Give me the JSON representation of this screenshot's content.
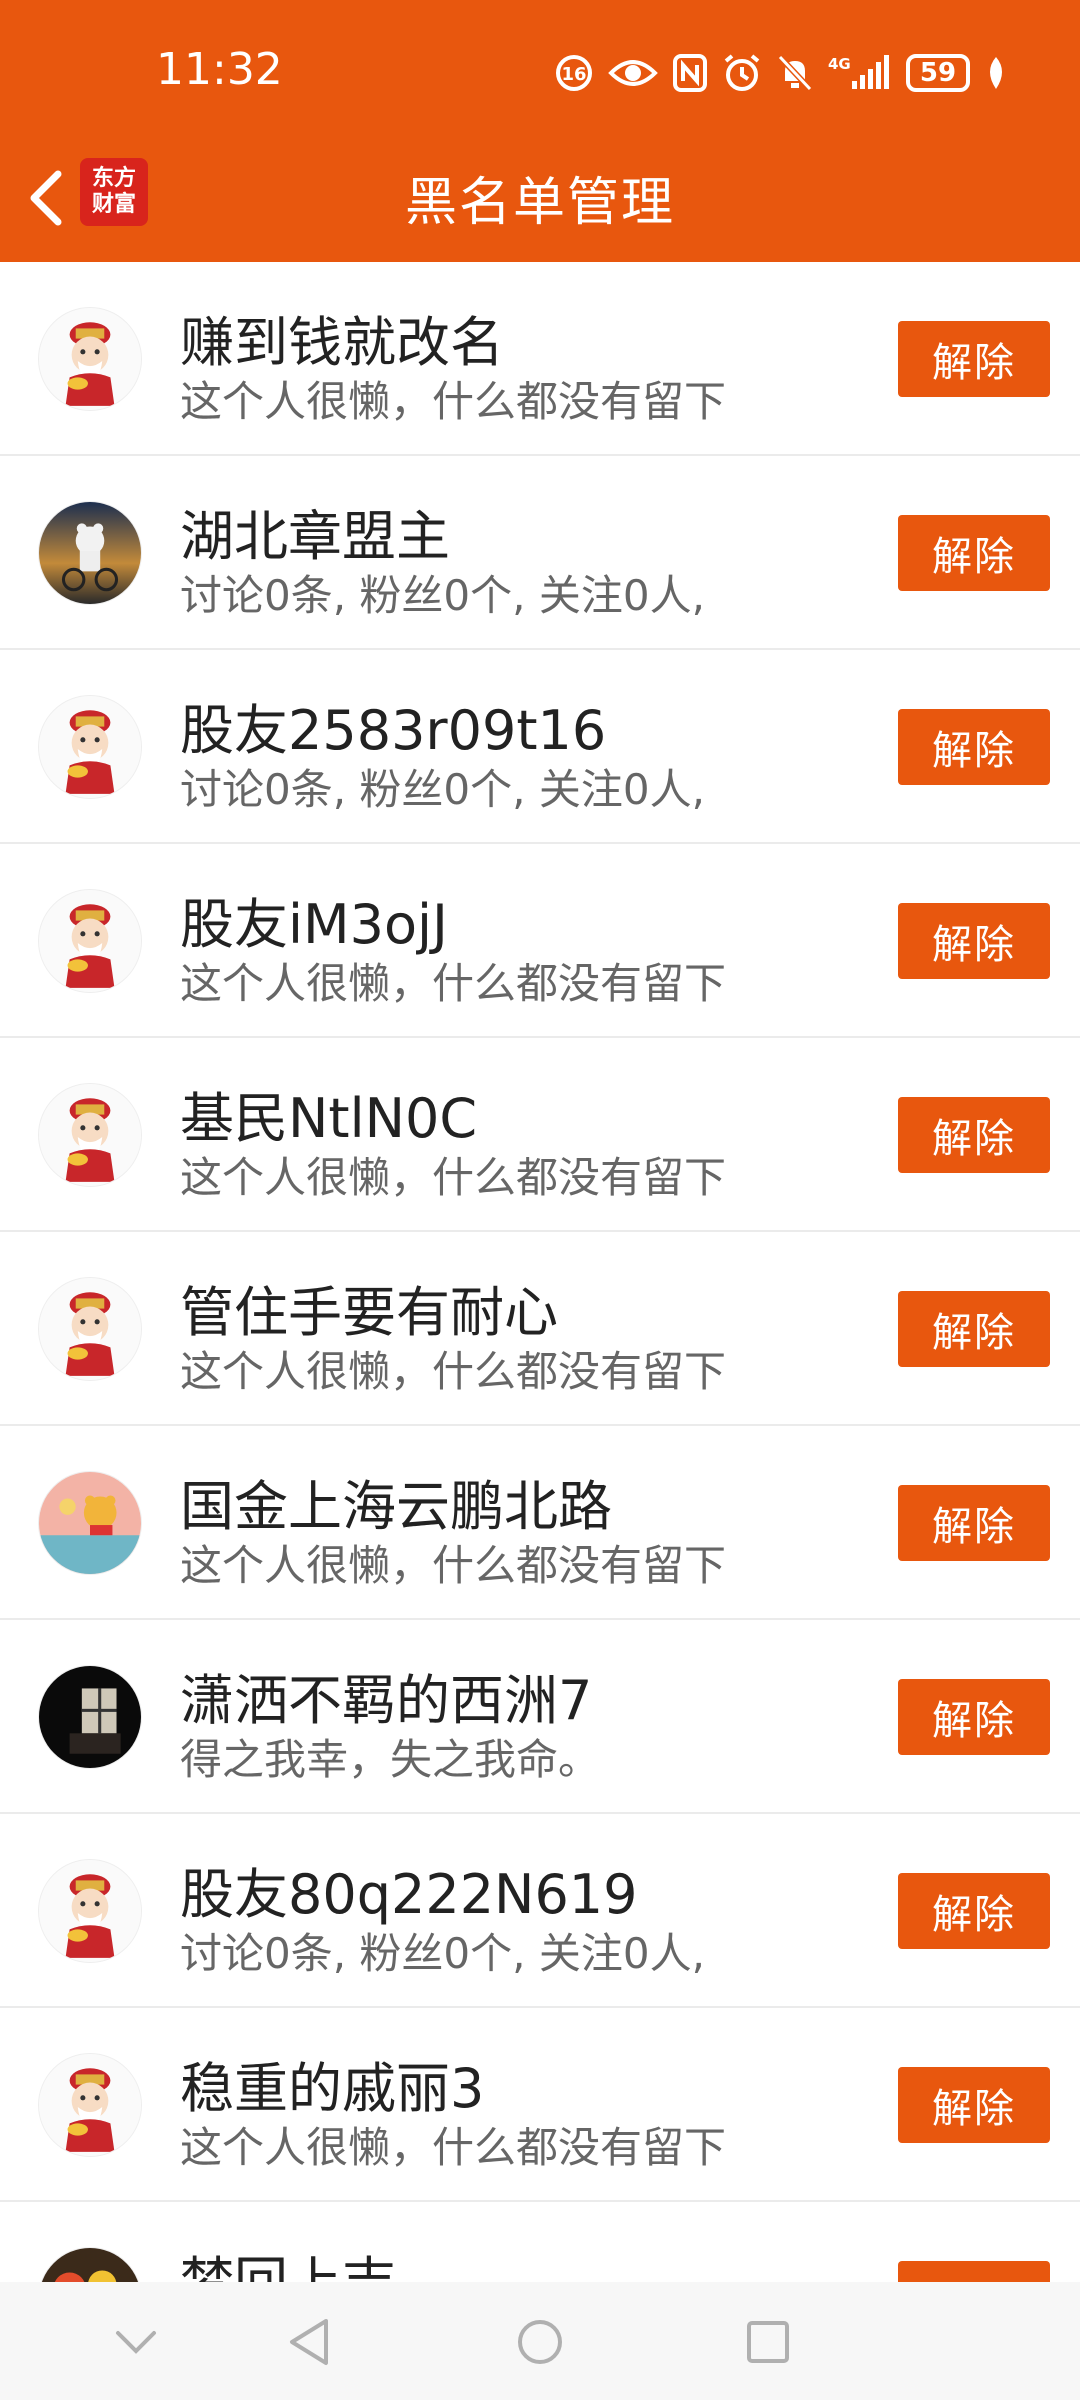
{
  "status_bar": {
    "time": "11:32",
    "battery": "59",
    "network": "4G",
    "icons": [
      "hd-icon",
      "eye-icon",
      "nfc-icon",
      "alarm-icon",
      "mute-icon",
      "signal-icon",
      "battery-icon",
      "leaf-icon"
    ]
  },
  "header": {
    "title": "黑名单管理",
    "logo_line1": "东方",
    "logo_line2": "财富",
    "brand_color": "#e8570e"
  },
  "list": {
    "button_label": "解除",
    "items": [
      {
        "name": "赚到钱就改名",
        "desc": "这个人很懒，什么都没有留下",
        "avatar": "default"
      },
      {
        "name": "湖北章盟主",
        "desc": "讨论0条, 粉丝0个, 关注0人,",
        "avatar": "photo-bear"
      },
      {
        "name": "股友2583r09t16",
        "desc": "讨论0条, 粉丝0个, 关注0人,",
        "avatar": "default"
      },
      {
        "name": "股友iM3ojJ",
        "desc": "这个人很懒，什么都没有留下",
        "avatar": "default"
      },
      {
        "name": "基民NtlN0C",
        "desc": "这个人很懒，什么都没有留下",
        "avatar": "default"
      },
      {
        "name": "管住手要有耐心",
        "desc": "这个人很懒，什么都没有留下",
        "avatar": "default"
      },
      {
        "name": "国金上海云鹏北路",
        "desc": "这个人很懒，什么都没有留下",
        "avatar": "photo-pooh"
      },
      {
        "name": "潇洒不羁的西洲7",
        "desc": "得之我幸，失之我命。",
        "avatar": "photo-window"
      },
      {
        "name": "股友80q222N619",
        "desc": "讨论0条, 粉丝0个, 关注0人,",
        "avatar": "default"
      },
      {
        "name": "稳重的戚丽3",
        "desc": "这个人很懒，什么都没有留下",
        "avatar": "default"
      },
      {
        "name": "梦回上吉",
        "desc": "",
        "avatar": "photo-fruit"
      }
    ]
  },
  "navbar": {
    "icons": [
      "chevron-down-icon",
      "back-triangle-icon",
      "home-circle-icon",
      "recents-square-icon"
    ]
  }
}
